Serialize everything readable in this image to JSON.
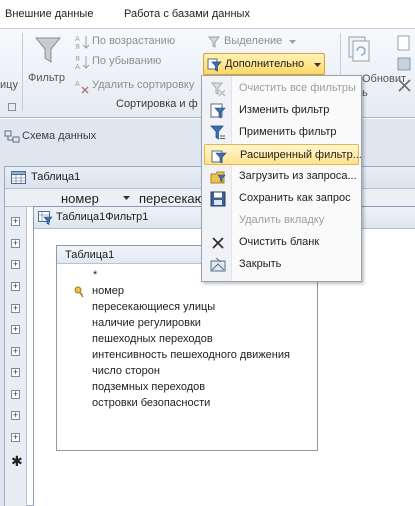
{
  "tabs": [
    "Внешние данные",
    "Работа с базами данных"
  ],
  "ribbon": {
    "filter_label": "Фильтр",
    "sort_asc": "По возрастанию",
    "sort_desc": "По убыванию",
    "remove_sort": "Удалить сортировку",
    "selection": "Выделение",
    "advanced": "Дополнительно",
    "group_label": "Сортировка и ф",
    "left_cut": "ицу",
    "update_all_cut": "Обновит",
    "update_cut": "ь"
  },
  "schema_label": "Схема данных",
  "table_window": {
    "title": "Таблица1",
    "columns": [
      "номер",
      "пересекающ"
    ]
  },
  "filter_window": {
    "title": "Таблица1Фильтр1",
    "box_title": "Таблица1",
    "fields": [
      "*",
      "номер",
      "пересекающиеся улицы",
      "наличие регулировки",
      "пешеходных переходов",
      "интенсивность пешеходного движения",
      "число сторон",
      "подземных переходов",
      "островки безопасности"
    ]
  },
  "menu": {
    "items": [
      {
        "label": "Очистить все фильтры",
        "icon": "clear-filters-icon",
        "disabled": true
      },
      {
        "label": "Изменить фильтр",
        "icon": "edit-filter-icon",
        "disabled": false
      },
      {
        "label": "Применить фильтр",
        "icon": "apply-filter-icon",
        "disabled": false
      },
      {
        "label": "Расширенный фильтр...",
        "icon": "advanced-filter-icon",
        "disabled": false,
        "highlighted": true
      },
      {
        "label": "Загрузить из запроса...",
        "icon": "load-query-icon",
        "disabled": false
      },
      {
        "label": "Сохранить как запрос",
        "icon": "save-query-icon",
        "disabled": false
      },
      {
        "label": "Удалить вкладку",
        "icon": "",
        "disabled": true
      },
      {
        "label": "Очистить бланк",
        "icon": "close-x-icon",
        "disabled": false
      },
      {
        "label": "Закрыть",
        "icon": "close-window-icon",
        "disabled": false
      }
    ]
  }
}
